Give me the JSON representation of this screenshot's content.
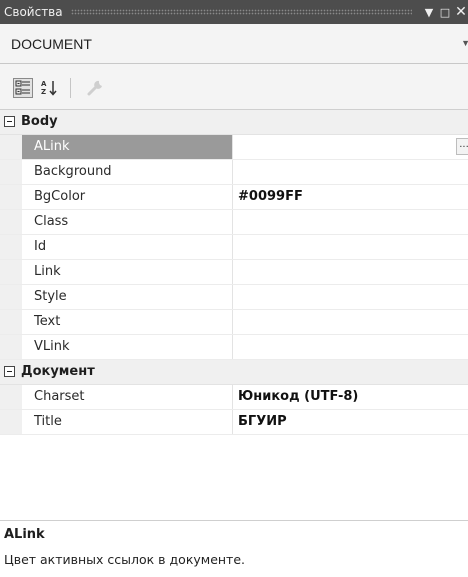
{
  "window": {
    "title": "Свойства",
    "buttons": {
      "dropdown": "▼",
      "maximize": "□",
      "close": "✕"
    }
  },
  "object_selector": {
    "selected": "DOCUMENT"
  },
  "toolbar": {
    "items": [
      {
        "icon": "categorized-icon",
        "active": true
      },
      {
        "icon": "alphabetical-sort-icon",
        "active": false
      },
      {
        "icon": "property-pages-icon",
        "active": false,
        "disabled": true
      }
    ]
  },
  "grid": {
    "categories": [
      {
        "name": "Body",
        "properties": [
          {
            "name": "ALink",
            "value": "",
            "selected": true,
            "has_ellipsis": true
          },
          {
            "name": "Background",
            "value": ""
          },
          {
            "name": "BgColor",
            "value": "#0099FF"
          },
          {
            "name": "Class",
            "value": ""
          },
          {
            "name": "Id",
            "value": ""
          },
          {
            "name": "Link",
            "value": ""
          },
          {
            "name": "Style",
            "value": ""
          },
          {
            "name": "Text",
            "value": ""
          },
          {
            "name": "VLink",
            "value": ""
          }
        ]
      },
      {
        "name": "Документ",
        "properties": [
          {
            "name": "Charset",
            "value": "Юникод (UTF-8)"
          },
          {
            "name": "Title",
            "value": "БГУИР"
          }
        ]
      }
    ],
    "ellipsis_label": "..."
  },
  "description": {
    "title": "ALink",
    "text": "Цвет активных ссылок в документе."
  }
}
